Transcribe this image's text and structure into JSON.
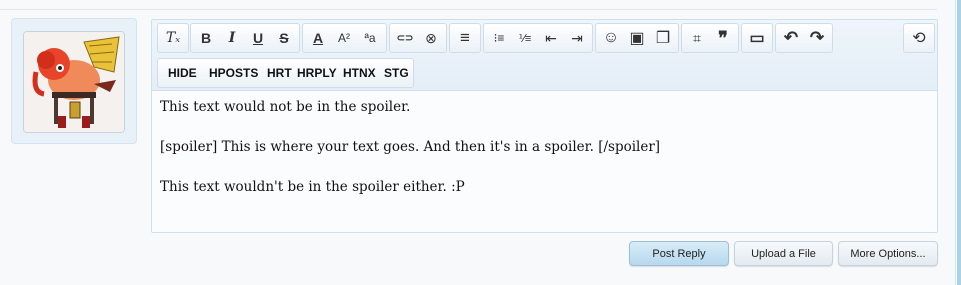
{
  "toolbar": {
    "groups": [
      {
        "name": "format",
        "buttons": [
          {
            "icon": "clear-format-icon",
            "glyph": "Tₓ"
          }
        ]
      },
      {
        "name": "text-style",
        "buttons": [
          {
            "icon": "bold-icon",
            "glyph": "B"
          },
          {
            "icon": "italic-icon",
            "glyph": "I"
          },
          {
            "icon": "underline-icon",
            "glyph": "U"
          },
          {
            "icon": "strikethrough-icon",
            "glyph": "S"
          }
        ]
      },
      {
        "name": "font",
        "buttons": [
          {
            "icon": "text-color-icon",
            "glyph": "A"
          },
          {
            "icon": "font-size-icon",
            "glyph": "A²"
          },
          {
            "icon": "font-family-icon",
            "glyph": "ªa"
          }
        ]
      },
      {
        "name": "links",
        "buttons": [
          {
            "icon": "link-icon",
            "glyph": "⊂⊃"
          },
          {
            "icon": "unlink-icon",
            "glyph": "⊗"
          }
        ]
      },
      {
        "name": "align",
        "buttons": [
          {
            "icon": "align-left-icon",
            "glyph": "≡"
          }
        ]
      },
      {
        "name": "lists",
        "buttons": [
          {
            "icon": "bullet-list-icon",
            "glyph": "⁝≡"
          },
          {
            "icon": "numbered-list-icon",
            "glyph": "⅟≡"
          },
          {
            "icon": "outdent-icon",
            "glyph": "⇤"
          },
          {
            "icon": "indent-icon",
            "glyph": "⇥"
          }
        ]
      },
      {
        "name": "media",
        "buttons": [
          {
            "icon": "smiley-icon",
            "glyph": "☺"
          },
          {
            "icon": "image-icon",
            "glyph": "▣"
          },
          {
            "icon": "media-icon",
            "glyph": "❐"
          }
        ]
      },
      {
        "name": "code",
        "buttons": [
          {
            "icon": "code-icon",
            "glyph": "⌗"
          },
          {
            "icon": "quote-icon",
            "glyph": "❞"
          }
        ]
      },
      {
        "name": "save",
        "buttons": [
          {
            "icon": "save-icon",
            "glyph": "▭"
          }
        ]
      },
      {
        "name": "history",
        "buttons": [
          {
            "icon": "undo-icon",
            "glyph": "↶"
          },
          {
            "icon": "redo-icon",
            "glyph": "↷"
          }
        ]
      },
      {
        "name": "toggle",
        "buttons": [
          {
            "icon": "toggle-bbcode-icon",
            "glyph": "⟲"
          }
        ]
      }
    ],
    "custom_tags": [
      "HIDE",
      "HPOSTS",
      "HRT",
      "HRPLY",
      "HTNX",
      "STG"
    ]
  },
  "editor": {
    "paragraphs": [
      "This text would not be in the spoiler.",
      "[spoiler] This is where your text goes. And then it's in a spoiler. [/spoiler]",
      "This text wouldn't be in the spoiler either. :P"
    ]
  },
  "actions": {
    "post_reply": "Post Reply",
    "upload_file": "Upload a File",
    "more_options": "More Options..."
  }
}
